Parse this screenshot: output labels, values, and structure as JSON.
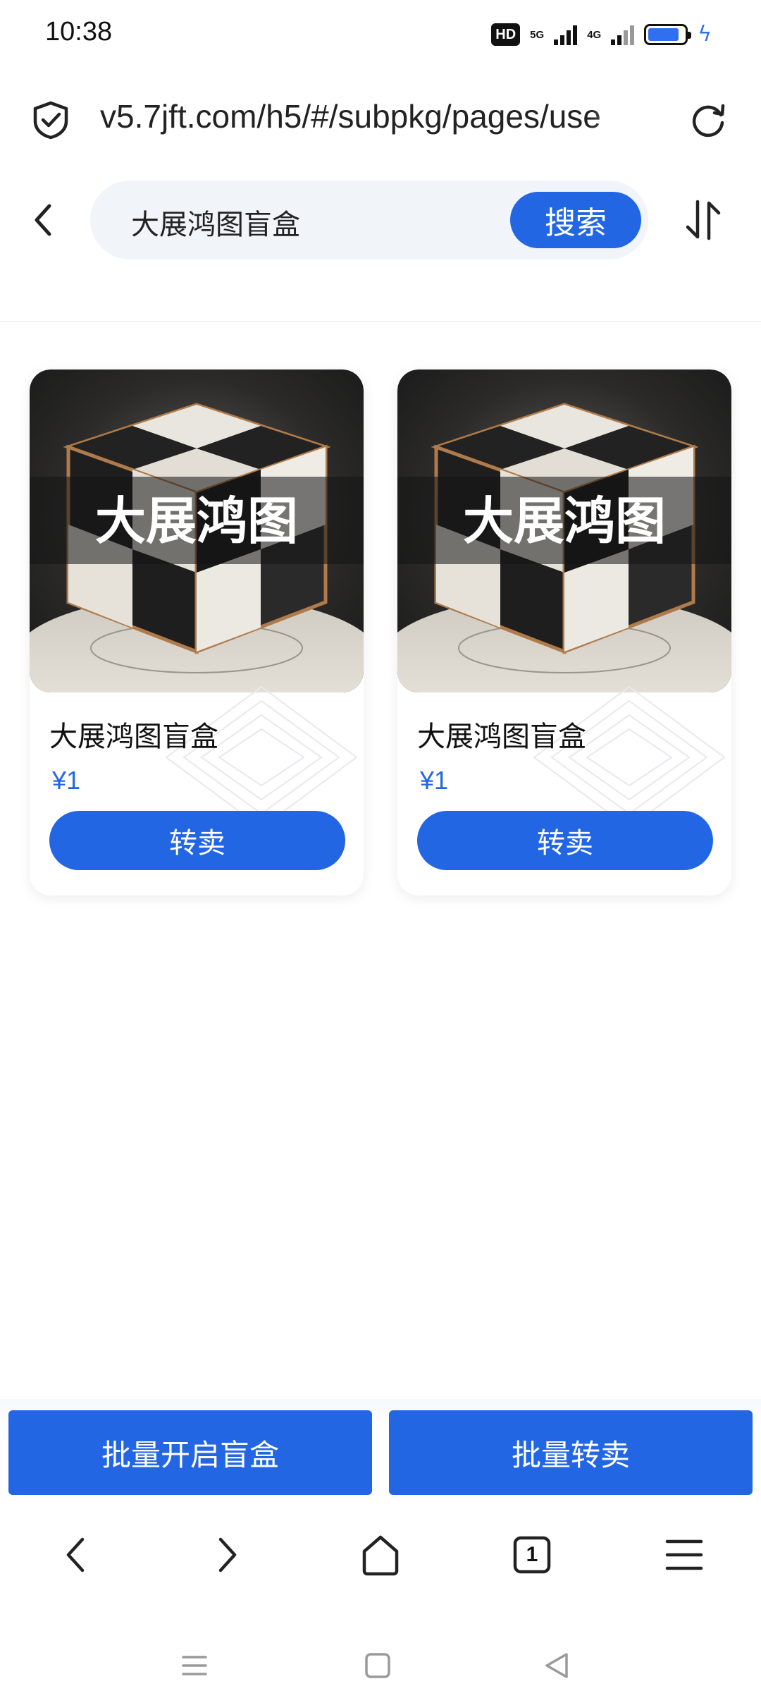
{
  "status_bar": {
    "time": "10:38",
    "hd_label": "HD",
    "network_5g": "5G",
    "network_4g": "4G",
    "battery_level": 0.85
  },
  "browser": {
    "url": "v5.7jft.com/h5/#/subpkg/pages/use"
  },
  "search": {
    "value": "大展鸿图盲盒",
    "button_label": "搜索"
  },
  "products": [
    {
      "title": "大展鸿图盲盒",
      "price": "¥1",
      "button_label": "转卖",
      "image_text": "大展鸿图"
    },
    {
      "title": "大展鸿图盲盒",
      "price": "¥1",
      "button_label": "转卖",
      "image_text": "大展鸿图"
    }
  ],
  "bottom_actions": {
    "open_label": "批量开启盲盒",
    "resell_label": "批量转卖"
  },
  "browser_nav": {
    "tab_count": "1"
  },
  "colors": {
    "accent": "#2266e3",
    "search_bg": "#f1f4f9"
  }
}
